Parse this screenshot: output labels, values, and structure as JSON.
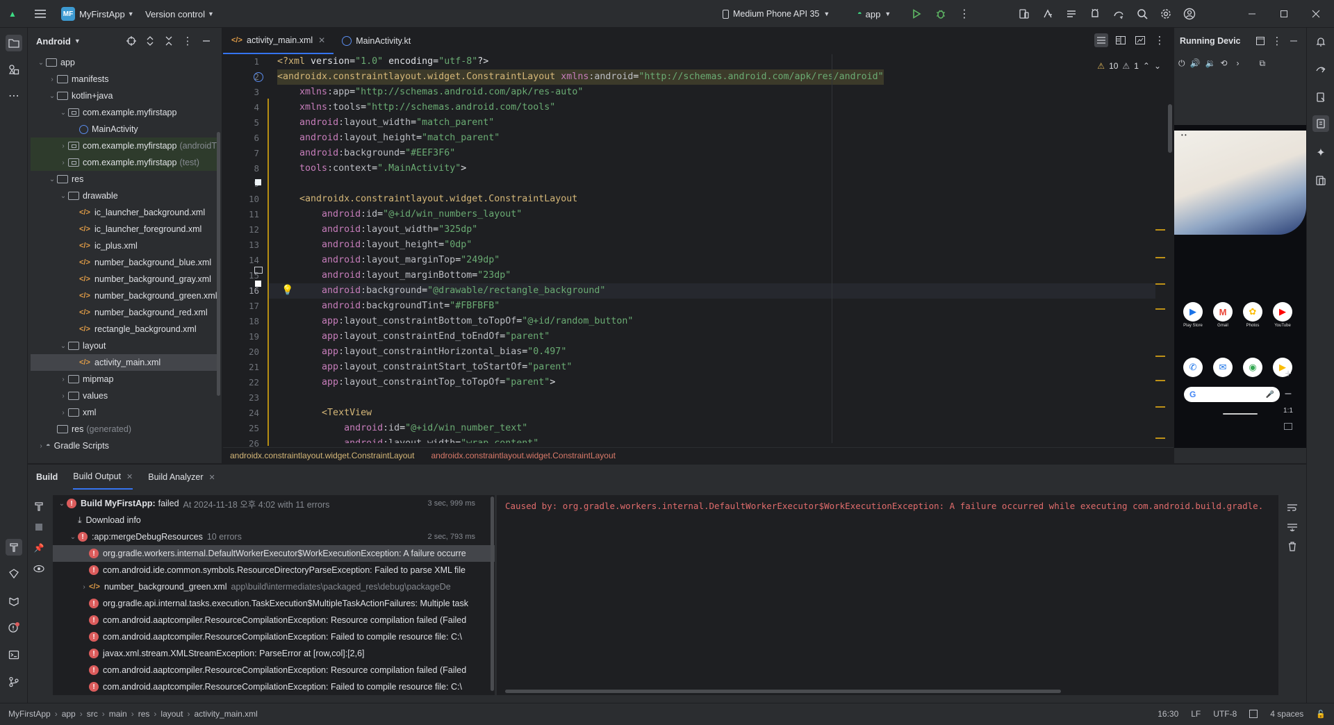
{
  "titlebar": {
    "project_badge": "MF",
    "project_name": "MyFirstApp",
    "vcs": "Version control",
    "device": "Medium Phone API 35",
    "run_config": "app"
  },
  "project_panel": {
    "view": "Android",
    "tree": [
      {
        "label": "app",
        "indent": 0,
        "chev": "v",
        "icon": "folder"
      },
      {
        "label": "manifests",
        "indent": 1,
        "chev": ">",
        "icon": "folder"
      },
      {
        "label": "kotlin+java",
        "indent": 1,
        "chev": "v",
        "icon": "folder"
      },
      {
        "label": "com.example.myfirstapp",
        "indent": 2,
        "chev": "v",
        "icon": "pkg"
      },
      {
        "label": "MainActivity",
        "indent": 3,
        "chev": "",
        "icon": "kotlin"
      },
      {
        "label": "com.example.myfirstapp",
        "suffix": "(androidT",
        "indent": 2,
        "chev": ">",
        "icon": "pkg",
        "hl": true
      },
      {
        "label": "com.example.myfirstapp",
        "suffix": "(test)",
        "indent": 2,
        "chev": ">",
        "icon": "pkg",
        "hl": true
      },
      {
        "label": "res",
        "indent": 1,
        "chev": "v",
        "icon": "folder"
      },
      {
        "label": "drawable",
        "indent": 2,
        "chev": "v",
        "icon": "folder"
      },
      {
        "label": "ic_launcher_background.xml",
        "indent": 3,
        "chev": "",
        "icon": "xml"
      },
      {
        "label": "ic_launcher_foreground.xml",
        "indent": 3,
        "chev": "",
        "icon": "xml"
      },
      {
        "label": "ic_plus.xml",
        "indent": 3,
        "chev": "",
        "icon": "xml"
      },
      {
        "label": "number_background_blue.xml",
        "indent": 3,
        "chev": "",
        "icon": "xml"
      },
      {
        "label": "number_background_gray.xml",
        "indent": 3,
        "chev": "",
        "icon": "xml"
      },
      {
        "label": "number_background_green.xml",
        "indent": 3,
        "chev": "",
        "icon": "xml"
      },
      {
        "label": "number_background_red.xml",
        "indent": 3,
        "chev": "",
        "icon": "xml"
      },
      {
        "label": "rectangle_background.xml",
        "indent": 3,
        "chev": "",
        "icon": "xml"
      },
      {
        "label": "layout",
        "indent": 2,
        "chev": "v",
        "icon": "folder"
      },
      {
        "label": "activity_main.xml",
        "indent": 3,
        "chev": "",
        "icon": "xml",
        "sel": true
      },
      {
        "label": "mipmap",
        "indent": 2,
        "chev": ">",
        "icon": "folder"
      },
      {
        "label": "values",
        "indent": 2,
        "chev": ">",
        "icon": "folder"
      },
      {
        "label": "xml",
        "indent": 2,
        "chev": ">",
        "icon": "folder"
      },
      {
        "label": "res",
        "suffix": "(generated)",
        "indent": 1,
        "chev": "",
        "icon": "folder"
      },
      {
        "label": "Gradle Scripts",
        "indent": 0,
        "chev": ">",
        "icon": "gradle"
      }
    ]
  },
  "editor": {
    "tabs": [
      {
        "label": "activity_main.xml",
        "active": true,
        "icon": "xml"
      },
      {
        "label": "MainActivity.kt",
        "active": false,
        "icon": "kotlin"
      }
    ],
    "warnings": "10",
    "weak_warnings": "1",
    "lines": [
      "<?xml version=\"1.0\" encoding=\"utf-8\"?>",
      "<androidx.constraintlayout.widget.ConstraintLayout xmlns:android=\"http://schemas.android.com/apk/res/android\"",
      "    xmlns:app=\"http://schemas.android.com/apk/res-auto\"",
      "    xmlns:tools=\"http://schemas.android.com/tools\"",
      "    android:layout_width=\"match_parent\"",
      "    android:layout_height=\"match_parent\"",
      "    android:background=\"#EEF3F6\"",
      "    tools:context=\".MainActivity\">",
      "",
      "    <androidx.constraintlayout.widget.ConstraintLayout",
      "        android:id=\"@+id/win_numbers_layout\"",
      "        android:layout_width=\"325dp\"",
      "        android:layout_height=\"0dp\"",
      "        android:layout_marginTop=\"249dp\"",
      "        android:layout_marginBottom=\"23dp\"",
      "        android:background=\"@drawable/rectangle_background\"",
      "        android:backgroundTint=\"#FBFBFB\"",
      "        app:layout_constraintBottom_toTopOf=\"@+id/random_button\"",
      "        app:layout_constraintEnd_toEndOf=\"parent\"",
      "        app:layout_constraintHorizontal_bias=\"0.497\"",
      "        app:layout_constraintStart_toStartOf=\"parent\"",
      "        app:layout_constraintTop_toTopOf=\"parent\">",
      "",
      "        <TextView",
      "            android:id=\"@+id/win_number_text\"",
      "            android:layout_width=\"wrap_content\""
    ],
    "breadcrumbs": [
      "androidx.constraintlayout.widget.ConstraintLayout",
      "androidx.constraintlayout.widget.ConstraintLayout"
    ]
  },
  "device_panel": {
    "title": "Running Devic",
    "apps_row1": [
      {
        "label": "Play Store",
        "color": "#1a73e8",
        "glyph": "▶"
      },
      {
        "label": "Gmail",
        "color": "#ffffff",
        "glyph": "M"
      },
      {
        "label": "Photos",
        "color": "#fbbc04",
        "glyph": "✿"
      },
      {
        "label": "YouTube",
        "color": "#ff0000",
        "glyph": "▶"
      }
    ],
    "apps_row2": [
      {
        "label": "",
        "color": "#1a73e8",
        "glyph": "✆"
      },
      {
        "label": "",
        "color": "#1a73e8",
        "glyph": "✉"
      },
      {
        "label": "",
        "color": "#34a853",
        "glyph": "◉"
      },
      {
        "label": "",
        "color": "#fbbc04",
        "glyph": "▶"
      }
    ],
    "zoom_label": "1:1"
  },
  "build": {
    "tabs": [
      "Build",
      "Build Output",
      "Build Analyzer"
    ],
    "tree": [
      {
        "label": "Build MyFirstApp:",
        "status": "failed",
        "detail": "At 2024-11-18 오후 4:02 with 11 errors",
        "time": "3 sec, 999 ms",
        "indent": 0,
        "chev": "v",
        "icon": "err"
      },
      {
        "label": "Download info",
        "indent": 1,
        "chev": "",
        "icon": "download"
      },
      {
        "label": ":app:mergeDebugResources",
        "detail": "10 errors",
        "time": "2 sec, 793 ms",
        "indent": 1,
        "chev": "v",
        "icon": "err"
      },
      {
        "label": "org.gradle.workers.internal.DefaultWorkerExecutor$WorkExecutionException: A failure occurre",
        "indent": 2,
        "chev": "",
        "icon": "err",
        "sel": true
      },
      {
        "label": "com.android.ide.common.symbols.ResourceDirectoryParseException: Failed to parse XML file",
        "indent": 2,
        "chev": "",
        "icon": "err"
      },
      {
        "label": "number_background_green.xml",
        "detail": "app\\build\\intermediates\\packaged_res\\debug\\packageDe",
        "indent": 2,
        "chev": ">",
        "icon": "xml"
      },
      {
        "label": "org.gradle.api.internal.tasks.execution.TaskExecution$MultipleTaskActionFailures: Multiple task",
        "indent": 2,
        "chev": "",
        "icon": "err"
      },
      {
        "label": "com.android.aaptcompiler.ResourceCompilationException: Resource compilation failed (Failed",
        "indent": 2,
        "chev": "",
        "icon": "err"
      },
      {
        "label": "com.android.aaptcompiler.ResourceCompilationException: Failed to compile resource file: C:\\",
        "indent": 2,
        "chev": "",
        "icon": "err"
      },
      {
        "label": "javax.xml.stream.XMLStreamException: ParseError at [row,col]:[2,6]",
        "indent": 2,
        "chev": "",
        "icon": "err"
      },
      {
        "label": "com.android.aaptcompiler.ResourceCompilationException: Resource compilation failed (Failed",
        "indent": 2,
        "chev": "",
        "icon": "err"
      },
      {
        "label": "com.android.aaptcompiler.ResourceCompilationException: Failed to compile resource file: C:\\",
        "indent": 2,
        "chev": "",
        "icon": "err"
      }
    ],
    "output": "Caused by: org.gradle.workers.internal.DefaultWorkerExecutor$WorkExecutionException: A failure occurred while executing com.android.build.gradle."
  },
  "statusbar": {
    "breadcrumbs": [
      "MyFirstApp",
      "app",
      "src",
      "main",
      "res",
      "layout",
      "activity_main.xml"
    ],
    "position": "16:30",
    "line_sep": "LF",
    "encoding": "UTF-8",
    "indent": "4 spaces"
  }
}
